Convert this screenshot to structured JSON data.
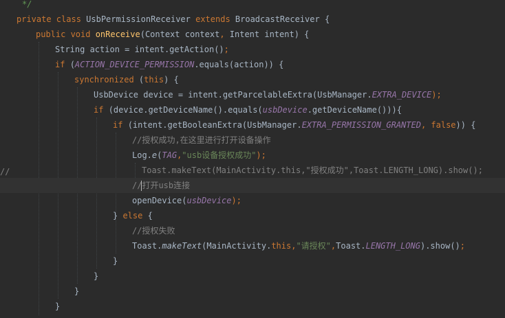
{
  "editor": {
    "lines": [
      {
        "segments": [
          {
            "t": "*/",
            "c": "cmt-doc"
          }
        ]
      },
      {
        "segments": [
          {
            "t": "private class ",
            "c": "kw"
          },
          {
            "t": "UsbPermissionReceiver ",
            "c": "plain"
          },
          {
            "t": "extends ",
            "c": "kw"
          },
          {
            "t": "BroadcastReceiver {",
            "c": "plain"
          }
        ]
      },
      {
        "segments": [
          {
            "t": "public void ",
            "c": "kw"
          },
          {
            "t": "onReceive",
            "c": "fn"
          },
          {
            "t": "(Context context",
            "c": "plain"
          },
          {
            "t": ", ",
            "c": "kw"
          },
          {
            "t": "Intent intent) {",
            "c": "plain"
          }
        ]
      },
      {
        "segments": [
          {
            "t": "String action = intent.getAction()",
            "c": "plain"
          },
          {
            "t": ";",
            "c": "kw"
          }
        ]
      },
      {
        "segments": [
          {
            "t": "if ",
            "c": "kw"
          },
          {
            "t": "(",
            "c": "plain"
          },
          {
            "t": "ACTION_DEVICE_PERMISSION",
            "c": "cst"
          },
          {
            "t": ".equals(action)) {",
            "c": "plain"
          }
        ]
      },
      {
        "segments": [
          {
            "t": "synchronized ",
            "c": "kw"
          },
          {
            "t": "(",
            "c": "plain"
          },
          {
            "t": "this",
            "c": "kw"
          },
          {
            "t": ") {",
            "c": "plain"
          }
        ]
      },
      {
        "segments": [
          {
            "t": "UsbDevice device = intent.getParcelableExtra(UsbManager.",
            "c": "plain"
          },
          {
            "t": "EXTRA_DEVICE",
            "c": "cst"
          },
          {
            "t": ");",
            "c": "kw"
          }
        ]
      },
      {
        "segments": [
          {
            "t": "if ",
            "c": "kw"
          },
          {
            "t": "(device.getDeviceName().equals(",
            "c": "plain"
          },
          {
            "t": "usbDevice",
            "c": "fld"
          },
          {
            "t": ".getDeviceName())){",
            "c": "plain"
          }
        ]
      },
      {
        "segments": [
          {
            "t": "if ",
            "c": "kw"
          },
          {
            "t": "(intent.getBooleanExtra(UsbManager.",
            "c": "plain"
          },
          {
            "t": "EXTRA_PERMISSION_GRANTED",
            "c": "cst"
          },
          {
            "t": ", ",
            "c": "kw"
          },
          {
            "t": "false",
            "c": "kw"
          },
          {
            "t": ")) {",
            "c": "plain"
          }
        ]
      },
      {
        "segments": [
          {
            "t": "//授权成功,在这里进行打开设备操作",
            "c": "cmt"
          }
        ]
      },
      {
        "segments": [
          {
            "t": "Log.",
            "c": "plain"
          },
          {
            "t": "e",
            "c": "plain ital"
          },
          {
            "t": "(",
            "c": "plain"
          },
          {
            "t": "TAG",
            "c": "cst"
          },
          {
            "t": ",",
            "c": "kw"
          },
          {
            "t": "\"usb设备授权成功\"",
            "c": "str"
          },
          {
            "t": ");",
            "c": "kw"
          }
        ]
      },
      {
        "segments": [
          {
            "t": "Toast.makeText(MainActivity.this,\"授权成功\",Toast.LENGTH_LONG).show();",
            "c": "cmt"
          }
        ]
      },
      {
        "segments": [
          {
            "t": "//",
            "c": "cmt"
          },
          {
            "t": "打开usb连接",
            "c": "cmt"
          }
        ]
      },
      {
        "segments": [
          {
            "t": "openDevice(",
            "c": "plain"
          },
          {
            "t": "usbDevice",
            "c": "fld"
          },
          {
            "t": ");",
            "c": "kw"
          }
        ]
      },
      {
        "segments": [
          {
            "t": "} ",
            "c": "plain"
          },
          {
            "t": "else ",
            "c": "kw"
          },
          {
            "t": "{",
            "c": "plain"
          }
        ]
      },
      {
        "segments": [
          {
            "t": "//授权失败",
            "c": "cmt"
          }
        ]
      },
      {
        "segments": [
          {
            "t": "Toast.",
            "c": "plain"
          },
          {
            "t": "makeText",
            "c": "plain ital"
          },
          {
            "t": "(MainActivity.",
            "c": "plain"
          },
          {
            "t": "this",
            "c": "kw"
          },
          {
            "t": ",",
            "c": "kw"
          },
          {
            "t": "\"请授权\"",
            "c": "str"
          },
          {
            "t": ",",
            "c": "kw"
          },
          {
            "t": "Toast.",
            "c": "plain"
          },
          {
            "t": "LENGTH_LONG",
            "c": "cst"
          },
          {
            "t": ").show()",
            "c": "plain"
          },
          {
            "t": ";",
            "c": "kw"
          }
        ]
      },
      {
        "segments": [
          {
            "t": "}",
            "c": "plain"
          }
        ]
      },
      {
        "segments": [
          {
            "t": "}",
            "c": "plain"
          }
        ]
      },
      {
        "segments": [
          {
            "t": "}",
            "c": "plain"
          }
        ]
      },
      {
        "segments": [
          {
            "t": "}",
            "c": "plain"
          }
        ]
      }
    ],
    "gutter": {
      "comment_marker": "//",
      "bulb_icon": "lightbulb-icon"
    },
    "colors": {
      "background": "#2b2b2b",
      "keyword": "#cc7832",
      "function": "#ffc66d",
      "constant": "#9876aa",
      "string": "#6a8759",
      "comment": "#808080",
      "plain": "#a9b7c6"
    }
  }
}
